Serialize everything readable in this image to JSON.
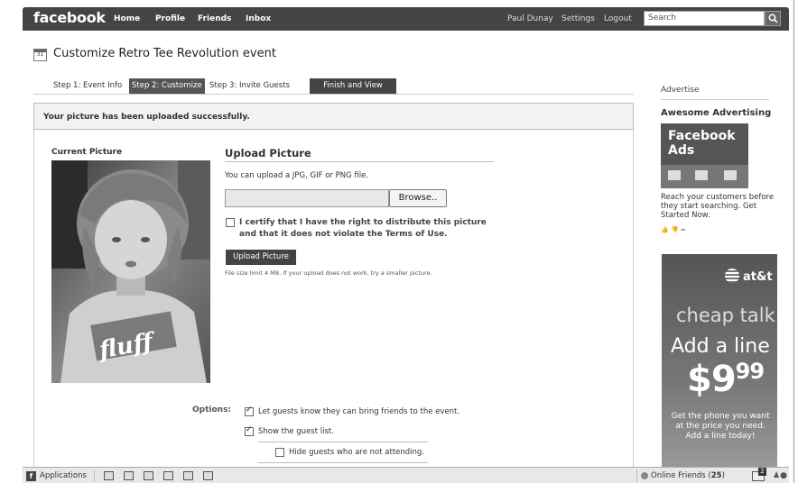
{
  "topbar": {
    "logo": "facebook",
    "nav": [
      "Home",
      "Profile",
      "Friends",
      "Inbox"
    ],
    "user": "Paul Dunay",
    "settings": "Settings",
    "logout": "Logout",
    "search_placeholder": "Search"
  },
  "page": {
    "title": "Customize Retro Tee Revolution event",
    "calendar_day": "31"
  },
  "tabs": [
    {
      "label": "Step 1: Event Info",
      "active": false
    },
    {
      "label": "Step 2: Customize",
      "active": true
    },
    {
      "label": "Step 3: Invite Guests",
      "active": false
    },
    {
      "label": "Finish and View",
      "active": false
    }
  ],
  "success_message": "Your picture has been uploaded successfully.",
  "current_picture": {
    "label": "Current Picture",
    "shirt_text": "fluff"
  },
  "upload": {
    "heading": "Upload Picture",
    "help": "You can upload a JPG, GIF or PNG file.",
    "file_value": "",
    "browse_label": "Browse..",
    "certify_text": "I certify that I have the right to distribute this picture and that it does not violate the Terms of Use.",
    "certify_checked": false,
    "button_label": "Upload Picture",
    "limit_text": "File size limit 4 MB. If your upload does not work, try a smaller picture."
  },
  "options": {
    "label": "Options:",
    "items": [
      {
        "text": "Let guests know they can bring friends to the event.",
        "checked": true
      },
      {
        "text": "Show the guest list.",
        "checked": true
      },
      {
        "text": "Hide guests who are not attending.",
        "checked": false
      }
    ]
  },
  "sidebar": {
    "advertise": "Advertise",
    "ad_title": "Awesome Advertising",
    "ad_box_text": "Facebook Ads",
    "ad_copy": "Reach your customers before they start searching. Get Started Now.",
    "att": {
      "logo": "at&t",
      "line1": "cheap talk",
      "line2": "Add a line",
      "price": "$9",
      "price_cents": "99",
      "line3": "Get the phone you want at the price you need. Add a line today!"
    }
  },
  "bottombar": {
    "applications": "Applications",
    "online_label": "Online Friends (",
    "online_count": "25",
    "online_close": ")",
    "notifications_count": "2"
  },
  "colors": {
    "topbar": "#444444",
    "active_tab": "#555555",
    "success_bg": "#f2f2f2"
  }
}
